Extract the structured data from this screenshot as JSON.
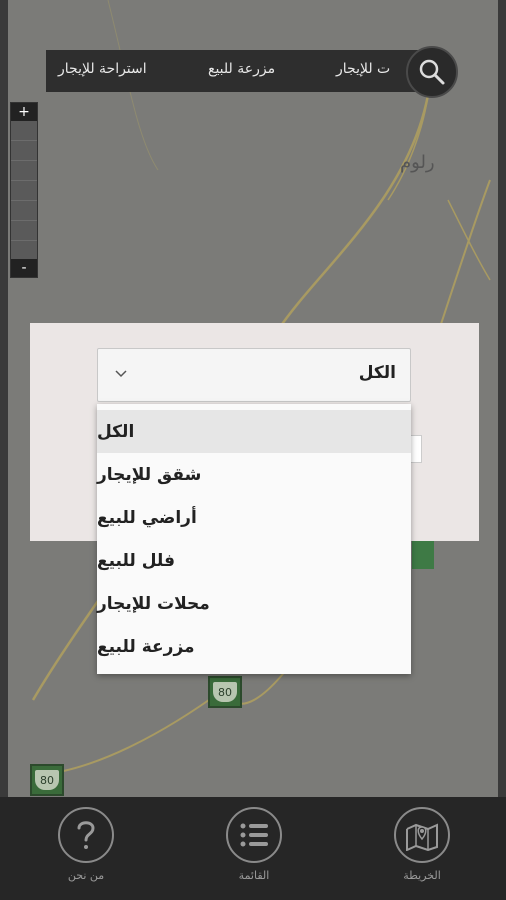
{
  "map": {
    "place_label": "رلوم",
    "route_badges": [
      "80",
      "80"
    ]
  },
  "top_bar": {
    "categories": [
      "ت للإيجار",
      "مزرعة للبيع",
      "استراحة للإيجار"
    ],
    "search_icon": "search-icon"
  },
  "zoom": {
    "in_label": "+",
    "out_label": "-"
  },
  "select": {
    "value": "الكل",
    "icon": "chevron-down-icon"
  },
  "dropdown": {
    "options": [
      "الكل",
      "شقق للإيجار",
      "أراضي للبيع",
      "فلل للبيع",
      "محلات للإيجار",
      "مزرعة للبيع"
    ],
    "selected_index": 0
  },
  "bottom_nav": {
    "items": [
      {
        "label": "من نحن",
        "icon": "question-icon"
      },
      {
        "label": "القائمة",
        "icon": "list-icon"
      },
      {
        "label": "الخريطة",
        "icon": "map-icon"
      }
    ]
  },
  "colors": {
    "map_bg": "#7b7b78",
    "road": "#a89a62",
    "bar_bg": "#2e2e2e",
    "nav_bg": "#262626",
    "modal_bg": "#ebe6e5",
    "route_green": "#3a6b3a"
  }
}
